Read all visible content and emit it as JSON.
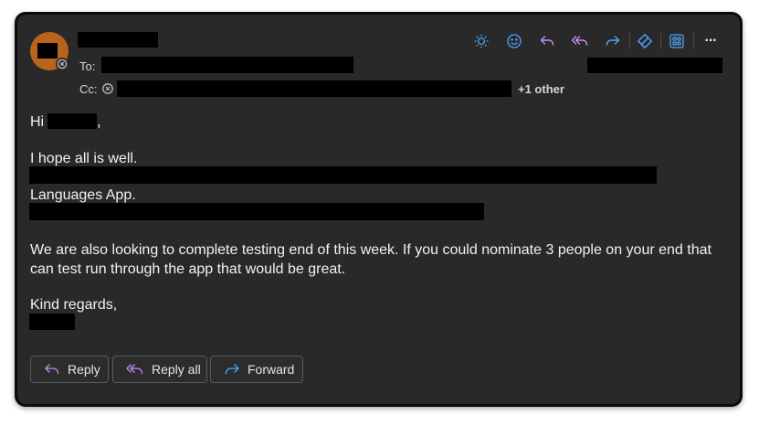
{
  "header": {
    "to_label": "To:",
    "cc_label": "Cc:",
    "cc_more": "+1 other"
  },
  "toolbar": {
    "icons": [
      "sun-icon",
      "emoji-icon",
      "reply-icon",
      "reply-all-icon",
      "forward-icon",
      "tag-icon",
      "apps-icon",
      "more-icon"
    ],
    "more_label": "···"
  },
  "body": {
    "greeting_prefix": "Hi",
    "greeting_suffix": ",",
    "line1": "I hope all is well.",
    "line3": "Languages App.",
    "para2_line1": "We are also looking to complete testing end of this week. If you could nominate 3 people on your end that",
    "para2_line2": "can test run through the app that would be great.",
    "closing": "Kind regards,"
  },
  "actions": {
    "reply_label": "Reply",
    "reply_all_label": "Reply all",
    "forward_label": "Forward"
  },
  "colors": {
    "accent_blue": "#4ca6ff",
    "accent_purple": "#c58af9",
    "avatar": "#b8651b"
  }
}
